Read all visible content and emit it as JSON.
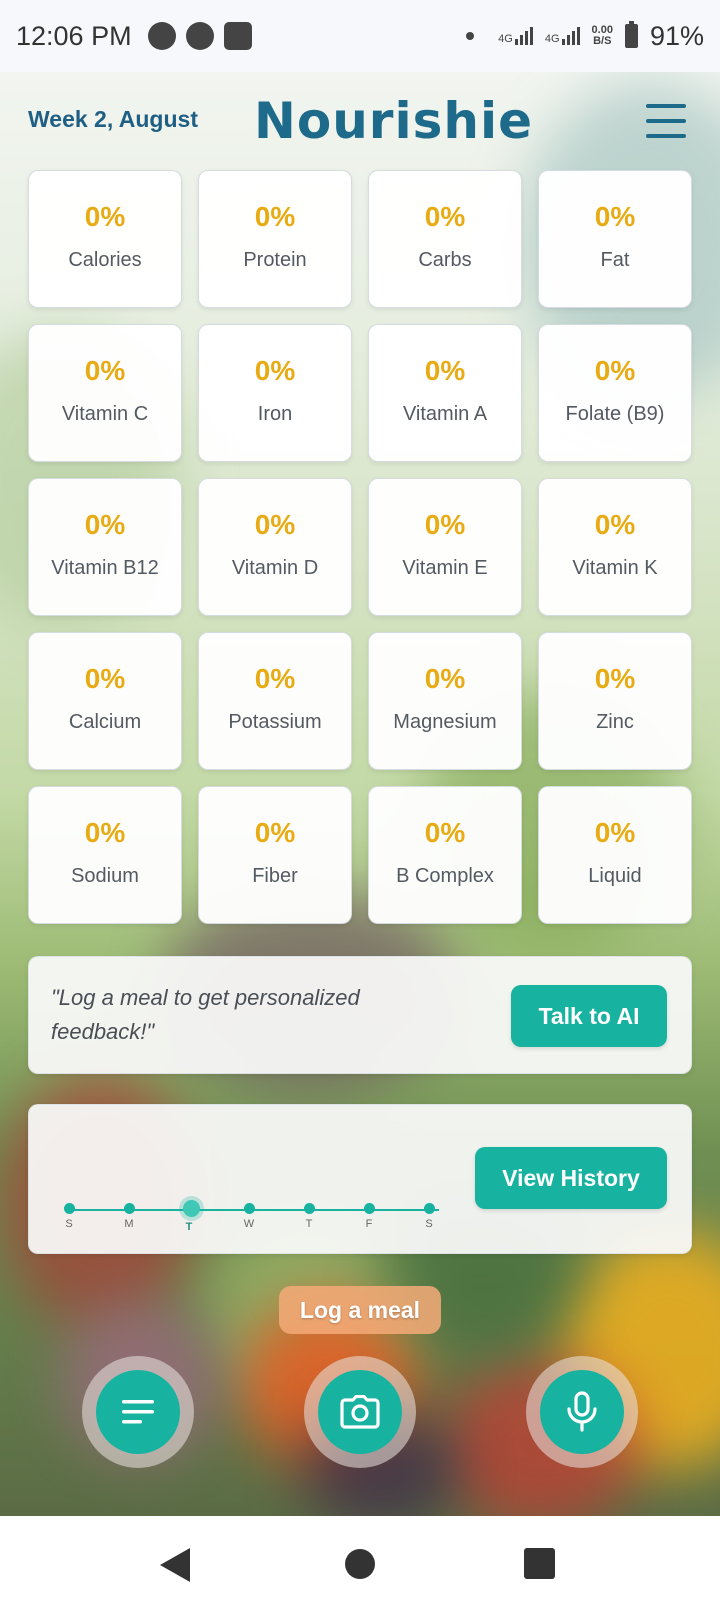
{
  "status_bar": {
    "time": "12:06 PM",
    "network_1": "4G",
    "network_2": "4G",
    "speed_top": "0.00",
    "speed_bottom": "B/S",
    "battery": "91%"
  },
  "header": {
    "week": "Week 2, August",
    "logo": "Nourishie"
  },
  "nutrients": [
    {
      "label": "Calories",
      "value": "0%"
    },
    {
      "label": "Protein",
      "value": "0%"
    },
    {
      "label": "Carbs",
      "value": "0%"
    },
    {
      "label": "Fat",
      "value": "0%"
    },
    {
      "label": "Vitamin C",
      "value": "0%"
    },
    {
      "label": "Iron",
      "value": "0%"
    },
    {
      "label": "Vitamin A",
      "value": "0%"
    },
    {
      "label": "Folate (B9)",
      "value": "0%"
    },
    {
      "label": "Vitamin B12",
      "value": "0%"
    },
    {
      "label": "Vitamin D",
      "value": "0%"
    },
    {
      "label": "Vitamin E",
      "value": "0%"
    },
    {
      "label": "Vitamin K",
      "value": "0%"
    },
    {
      "label": "Calcium",
      "value": "0%"
    },
    {
      "label": "Potassium",
      "value": "0%"
    },
    {
      "label": "Magnesium",
      "value": "0%"
    },
    {
      "label": "Zinc",
      "value": "0%"
    },
    {
      "label": "Sodium",
      "value": "0%"
    },
    {
      "label": "Fiber",
      "value": "0%"
    },
    {
      "label": "B Complex",
      "value": "0%"
    },
    {
      "label": "Liquid",
      "value": "0%"
    }
  ],
  "feedback": {
    "text": "\"Log a meal to get personalized feedback!\"",
    "button": "Talk to AI"
  },
  "history": {
    "button": "View History",
    "days": [
      "S",
      "M",
      "T",
      "W",
      "T",
      "F",
      "S"
    ],
    "active_day_index": 2
  },
  "log_meal": {
    "label": "Log a meal",
    "actions": [
      "list-icon",
      "camera-icon",
      "microphone-icon"
    ]
  },
  "colors": {
    "accent": "#18b3a0",
    "value": "#e8ab14",
    "brand": "#1e6a8a"
  }
}
